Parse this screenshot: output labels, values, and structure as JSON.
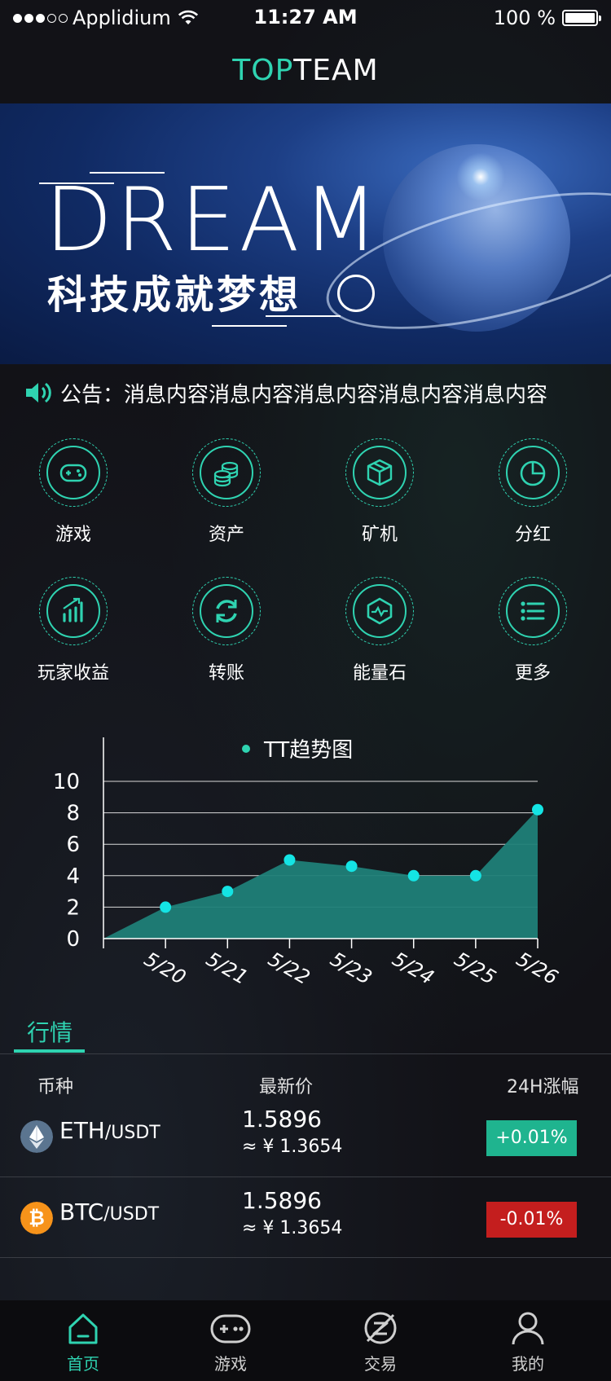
{
  "status_bar": {
    "carrier": "Applidium",
    "time": "11:27 AM",
    "battery": "100 %"
  },
  "nav": {
    "title_accent": "TOP",
    "title_rest": "TEAM"
  },
  "banner": {
    "headline": "DREAM",
    "slogan": "科技成就梦想"
  },
  "notice": {
    "label": "公告：",
    "text": "消息内容消息内容消息内容消息内容消息内容"
  },
  "menu": {
    "items": [
      {
        "label": "游戏",
        "icon": "gamepad-icon"
      },
      {
        "label": "资产",
        "icon": "coins-icon"
      },
      {
        "label": "矿机",
        "icon": "cube-icon"
      },
      {
        "label": "分红",
        "icon": "pie-chart-icon"
      },
      {
        "label": "玩家收益",
        "icon": "bar-growth-icon"
      },
      {
        "label": "转账",
        "icon": "refresh-icon"
      },
      {
        "label": "能量石",
        "icon": "energy-stone-icon"
      },
      {
        "label": "更多",
        "icon": "list-icon"
      }
    ]
  },
  "chart_data": {
    "type": "area",
    "title": "TT趋势图",
    "categories": [
      "5/20",
      "5/21",
      "5/22",
      "5/23",
      "5/24",
      "5/25",
      "5/26"
    ],
    "x_start_value": 0,
    "values": [
      2,
      3,
      5,
      4.6,
      4,
      4,
      8.2
    ],
    "ylim": [
      0,
      10
    ],
    "yticks": [
      0,
      2,
      4,
      6,
      8,
      10
    ],
    "grid": true,
    "colors": {
      "area": "#1f8078",
      "point": "#14e4e4",
      "grid": "#d9d9d9"
    }
  },
  "market": {
    "tab_label": "行情",
    "headers": {
      "coin": "币种",
      "price": "最新价",
      "change": "24H涨幅"
    },
    "rows": [
      {
        "base": "ETH",
        "quote": "/USDT",
        "price": "1.5896",
        "cny": "≈ ¥ 1.3654",
        "change": "+0.01%",
        "change_color": "#1fb48f",
        "icon": "ethereum-icon"
      },
      {
        "base": "BTC",
        "quote": "/USDT",
        "price": "1.5896",
        "cny": "≈ ¥ 1.3654",
        "change": "-0.01%",
        "change_color": "#c41e1e",
        "icon": "bitcoin-icon"
      }
    ]
  },
  "tabbar": {
    "items": [
      {
        "label": "首页",
        "icon": "home-icon",
        "active": true
      },
      {
        "label": "游戏",
        "icon": "gamepad-icon",
        "active": false
      },
      {
        "label": "交易",
        "icon": "trade-icon",
        "active": false
      },
      {
        "label": "我的",
        "icon": "user-icon",
        "active": false
      }
    ]
  },
  "theme": {
    "accent": "#2fd3b1",
    "background": "#121217"
  }
}
